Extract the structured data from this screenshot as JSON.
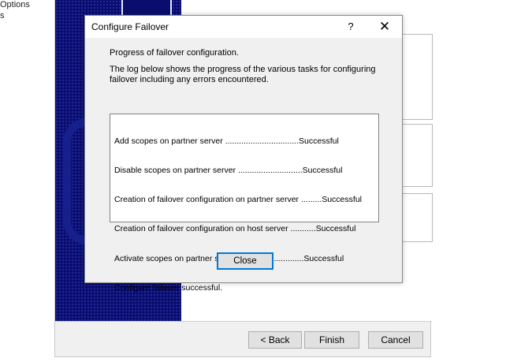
{
  "background_left": {
    "line1": "Options",
    "line2": "s"
  },
  "wizard": {
    "buttons": {
      "back": "< Back",
      "finish": "Finish",
      "cancel": "Cancel"
    }
  },
  "dialog": {
    "title": "Configure Failover",
    "help": "?",
    "close_glyph": "✕",
    "progress_heading": "Progress of failover configuration.",
    "log_description": "The log below shows the progress of the various tasks for configuring failover including any errors encountered.",
    "log_lines": [
      "Add scopes on partner server ................................Successful",
      "Disable scopes on partner server ............................Successful",
      "Creation of failover configuration on partner server .........Successful",
      "Creation of failover configuration on host server ...........Successful",
      "Activate scopes on partner server.............................Successful",
      "Configure failover successful."
    ],
    "close_button": "Close"
  },
  "colors": {
    "banner": "#0b0d6e",
    "focus_border": "#0078d7"
  }
}
